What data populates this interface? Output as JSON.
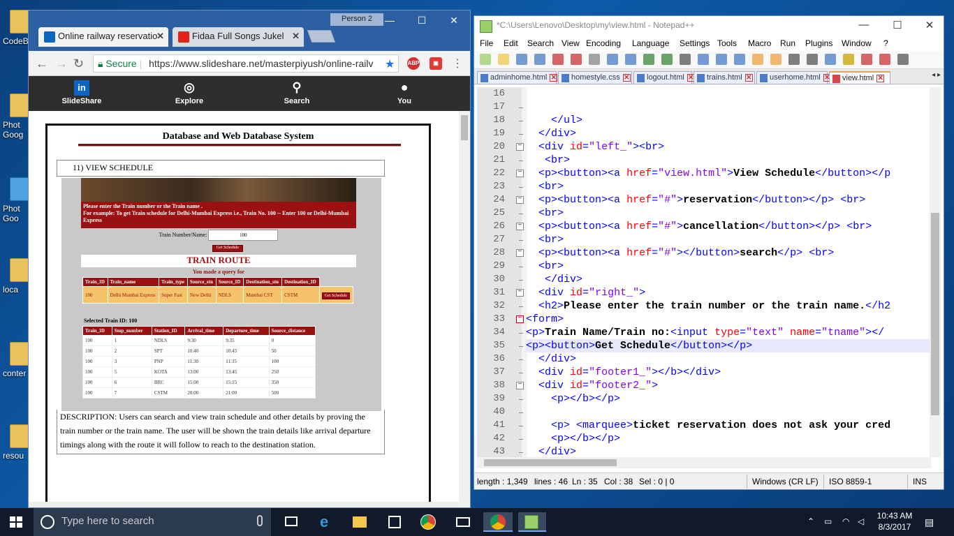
{
  "desktop": {
    "icons": [
      "CodeB",
      "Phot\nGoog",
      "Phot\nGoo",
      "loca",
      "conter",
      "resou"
    ]
  },
  "chrome": {
    "person": "Person 2",
    "tabs": [
      {
        "label": "Online railway reservatio",
        "icon_color": "#0a66c2"
      },
      {
        "label": "Fidaa Full Songs Jukel",
        "icon_color": "#e62117"
      }
    ],
    "address": {
      "secure": "Secure",
      "url": "https://www.slideshare.net/masterpiyush/online-railv"
    },
    "nav": [
      {
        "label": "SlideShare",
        "icon": "in"
      },
      {
        "label": "Explore",
        "icon": "◎"
      },
      {
        "label": "Search",
        "icon": "⚲"
      },
      {
        "label": "You",
        "icon": "●"
      }
    ],
    "doc": {
      "title": "Database and Web Database System",
      "section": "11) VIEW SCHEDULE",
      "instruction_lines": [
        "Please enter the Train number or the Train name .",
        "For example: To get Train schedule for Delhi-Mumbai Express i.e., Train No. 100 -- Enter 100 or Delhi-Mumbai Express"
      ],
      "train_number_label": "Train Number/Name:",
      "train_number_value": "100",
      "get_schedule": "Get Schedule",
      "route_title": "TRAIN ROUTE",
      "made_query": "You made a query for",
      "route_headers": [
        "Train_ID",
        "Train_name",
        "Train_type",
        "Source_stn",
        "Source_ID",
        "Destination_stn",
        "Destination_ID"
      ],
      "route_row": [
        "100",
        "Delhi Mumbai Express",
        "Super Fast",
        "New Delhi",
        "NDLS",
        "Mumbai CST",
        "CSTM"
      ],
      "selected_train": "Selected Train ID:     100",
      "stop_headers": [
        "Train_ID",
        "Stop_number",
        "Station_ID",
        "Arrival_time",
        "Departure_time",
        "Source_distance"
      ],
      "stops": [
        [
          "100",
          "1",
          "NDLS",
          "9:30",
          "9:35",
          "0"
        ],
        [
          "100",
          "2",
          "SPT",
          "10:40",
          "10:45",
          "50"
        ],
        [
          "100",
          "3",
          "PNP",
          "11:30",
          "11:35",
          "100"
        ],
        [
          "100",
          "5",
          "KOTA",
          "13:00",
          "13:45",
          "250"
        ],
        [
          "100",
          "6",
          "BRC",
          "15:00",
          "15:15",
          "350"
        ],
        [
          "100",
          "7",
          "CSTM",
          "20:00",
          "21:00",
          "500"
        ]
      ],
      "description": "DESCRIPTION: Users can search and view train schedule and other details by proving the train number or the train name. The user will be shown the train details like arrival departure timings along with the route it will follow to reach to the destination station."
    }
  },
  "npp": {
    "title": "*C:\\Users\\Lenovo\\Desktop\\my\\view.html - Notepad++",
    "menu": [
      "File",
      "Edit",
      "Search",
      "View",
      "Encoding",
      "Language",
      "Settings",
      "Tools",
      "Macro",
      "Run",
      "Plugins",
      "Window",
      "?"
    ],
    "tabs": [
      "adminhome.html",
      "homestyle.css",
      "logout.html",
      "trains.html",
      "userhome.html",
      "view.html"
    ],
    "line_numbers": [
      "16",
      "17",
      "18",
      "19",
      "20",
      "21",
      "22",
      "23",
      "24",
      "25",
      "26",
      "27",
      "28",
      "29",
      "30",
      "31",
      "32",
      "33",
      "34",
      "35",
      "36",
      "37",
      "38",
      "39",
      "40",
      "41",
      "42",
      "43"
    ],
    "code": [
      "",
      "",
      "    </ul>",
      "  </div>",
      "  <div id=\"left_\"><br>",
      "   <br>",
      "  <p><button><a href=\"view.html\">View Schedule</button></p",
      "  <br>",
      "  <p><button><a href=\"#\">reservation</button></p> <br>",
      "  <br>",
      "  <p><button><a href=\"#\">cancellation</button></p> <br>",
      "  <br>",
      "  <p><button><a href=\"#\"></button>search</p> <br>",
      "  <br>",
      "   </div>",
      "  <div id=\"right_\">",
      "  <h2>Please enter the train number or the train name.</h2",
      "<form>",
      "<p>Train Name/Train no:<input type=\"text\" name=\"tname\"></",
      "<p><button>Get Schedule</button></p>",
      "  </div>",
      "  <div id=\"footer1_\"></b></div>",
      "  <div id=\"footer2_\">",
      "    <p></b></p>",
      "",
      "    <p> <marquee>ticket reservation does not ask your cred",
      "    <p></b></p>",
      "  </div>"
    ],
    "status": {
      "length": "length : 1,349",
      "lines": "lines : 46",
      "ln": "Ln : 35",
      "col": "Col : 38",
      "sel": "Sel : 0 | 0",
      "eol": "Windows (CR LF)",
      "enc": "ISO 8859-1",
      "ins": "INS"
    }
  },
  "taskbar": {
    "search_placeholder": "Type here to search",
    "time": "10:43 AM",
    "date": "8/3/2017"
  }
}
